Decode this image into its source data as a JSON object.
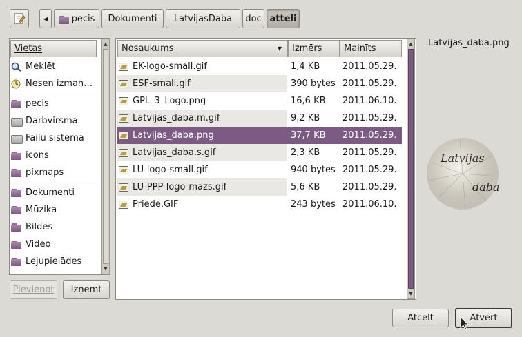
{
  "pathbar": {
    "crumbs": [
      "pecis",
      "Dokumenti",
      "LatvijasDaba",
      "doc",
      "atteli"
    ]
  },
  "sidebar": {
    "header": "Vietas",
    "items": [
      {
        "label": "Meklēt",
        "icon": "search-icon"
      },
      {
        "label": "Nesen izman…",
        "icon": "recent-icon"
      },
      {
        "label": "pecis",
        "icon": "home-folder-icon"
      },
      {
        "label": "Darbvirsma",
        "icon": "desktop-icon"
      },
      {
        "label": "Failu sistēma",
        "icon": "filesystem-icon"
      },
      {
        "label": "icons",
        "icon": "folder-icon"
      },
      {
        "label": "pixmaps",
        "icon": "folder-icon"
      },
      {
        "label": "Dokumenti",
        "icon": "folder-icon"
      },
      {
        "label": "Mūzika",
        "icon": "folder-icon"
      },
      {
        "label": "Bildes",
        "icon": "folder-icon"
      },
      {
        "label": "Video",
        "icon": "folder-icon"
      },
      {
        "label": "Lejupielādes",
        "icon": "folder-icon"
      }
    ],
    "add_label": "Pievienot",
    "remove_label": "Izņemt"
  },
  "filelist": {
    "columns": [
      "Nosaukums",
      "Izmērs",
      "Mainīts"
    ],
    "rows": [
      {
        "name": "EK-logo-small.gif",
        "size": "1,4 KB",
        "modified": "2011.05.29."
      },
      {
        "name": "ESF-small.gif",
        "size": "390 bytes",
        "modified": "2011.05.29."
      },
      {
        "name": "GPL_3_Logo.png",
        "size": "16,6 KB",
        "modified": "2011.06.10."
      },
      {
        "name": "Latvijas_daba.m.gif",
        "size": "9,2 KB",
        "modified": "2011.05.29."
      },
      {
        "name": "Latvijas_daba.png",
        "size": "37,7 KB",
        "modified": "2011.05.29."
      },
      {
        "name": "Latvijas_daba.s.gif",
        "size": "2,3 KB",
        "modified": "2011.05.29."
      },
      {
        "name": "LU-logo-small.gif",
        "size": "940 bytes",
        "modified": "2011.05.29."
      },
      {
        "name": "LU-PPP-logo-mazs.gif",
        "size": "5,6 KB",
        "modified": "2011.05.29."
      },
      {
        "name": "Priede.GIF",
        "size": "243 bytes",
        "modified": "2011.06.10."
      }
    ],
    "selected_index": 4
  },
  "preview": {
    "filename": "Latvijas_daba.png",
    "logo_line1": "Latvijas",
    "logo_line2": "daba"
  },
  "actions": {
    "cancel_label": "Atcelt",
    "open_label": "Atvērt"
  },
  "colors": {
    "selection": "#7b5b83",
    "scrollbar_accent": "#7b5b83"
  }
}
